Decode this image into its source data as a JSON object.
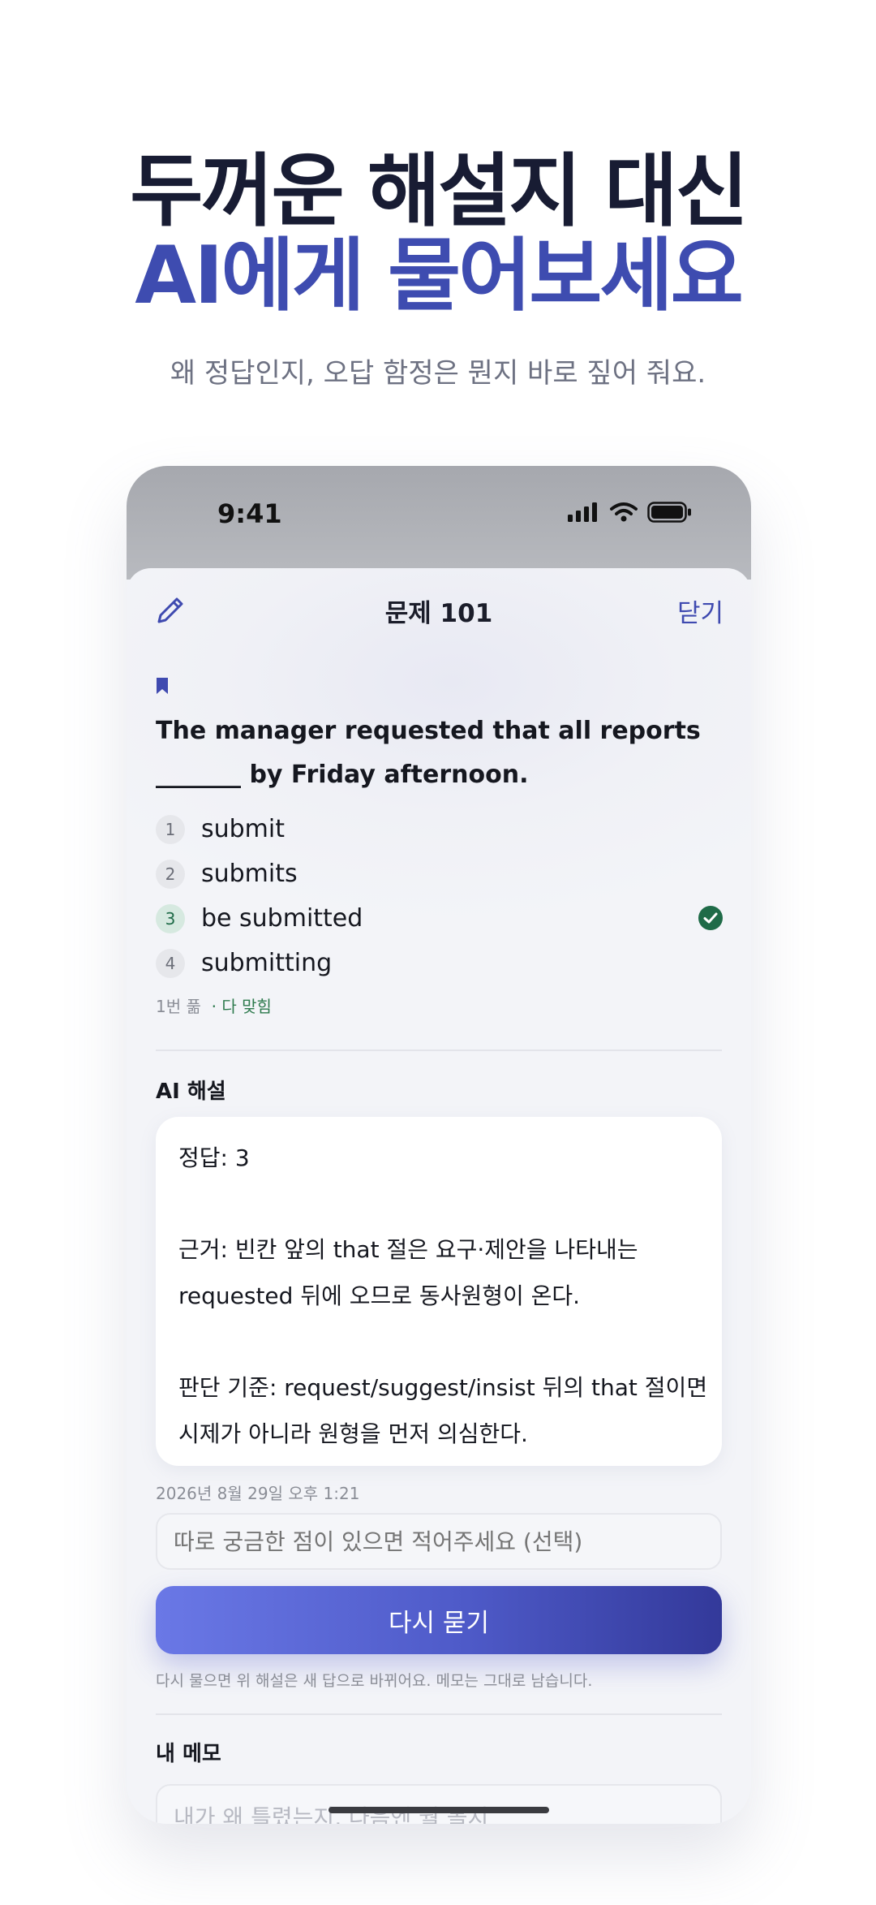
{
  "hero": {
    "title_line1": "두꺼운 해설지 대신",
    "title_line2": "AI에게 물어보세요",
    "subtitle": "왜 정답인지, 오답 함정은 뭔지 바로 짚어 줘요."
  },
  "status_bar": {
    "time": "9:41",
    "icons": [
      "cellular-signal-icon",
      "wifi-icon",
      "battery-icon"
    ]
  },
  "nav": {
    "edit_icon": "pencil-icon",
    "title": "문제 101",
    "close_label": "닫기"
  },
  "question": {
    "bookmark_icon": "bookmark-icon",
    "text": "The manager requested that all reports _______ by Friday afternoon.",
    "choices": [
      {
        "number": "1",
        "label": "submit"
      },
      {
        "number": "2",
        "label": "submits"
      },
      {
        "number": "3",
        "label": "be submitted",
        "correct": true
      },
      {
        "number": "4",
        "label": "submitting"
      }
    ],
    "attempts": "1번 풂",
    "result": "· 다 맞힘"
  },
  "ai_explanation": {
    "heading": "AI 해설",
    "answer": "정답: 3",
    "reason_line1": "근거: 빈칸 앞의 that 절은 요구·제안을 나타내는",
    "reason_line2": "requested 뒤에 오므로 동사원형이 온다.",
    "criteria_line1": "판단 기준: request/suggest/insist 뒤의 that 절이면",
    "criteria_line2": "시제가 아니라 원형을 먼저 의심한다.",
    "timestamp": "2026년 8월 29일 오후 1:21",
    "followup_placeholder": "따로 궁금한 점이 있으면 적어주세요 (선택)",
    "ask_again_label": "다시 묻기",
    "note": "다시 물으면 위 해설은 새 답으로 바뀌어요. 메모는 그대로 남습니다."
  },
  "memo": {
    "heading": "내 메모",
    "placeholder": "내가 왜 틀렸는지, 다음엔 뭘 볼지"
  },
  "colors": {
    "accent": "#3e4cb0",
    "title": "#181c33",
    "correct": "#1f6b48"
  }
}
